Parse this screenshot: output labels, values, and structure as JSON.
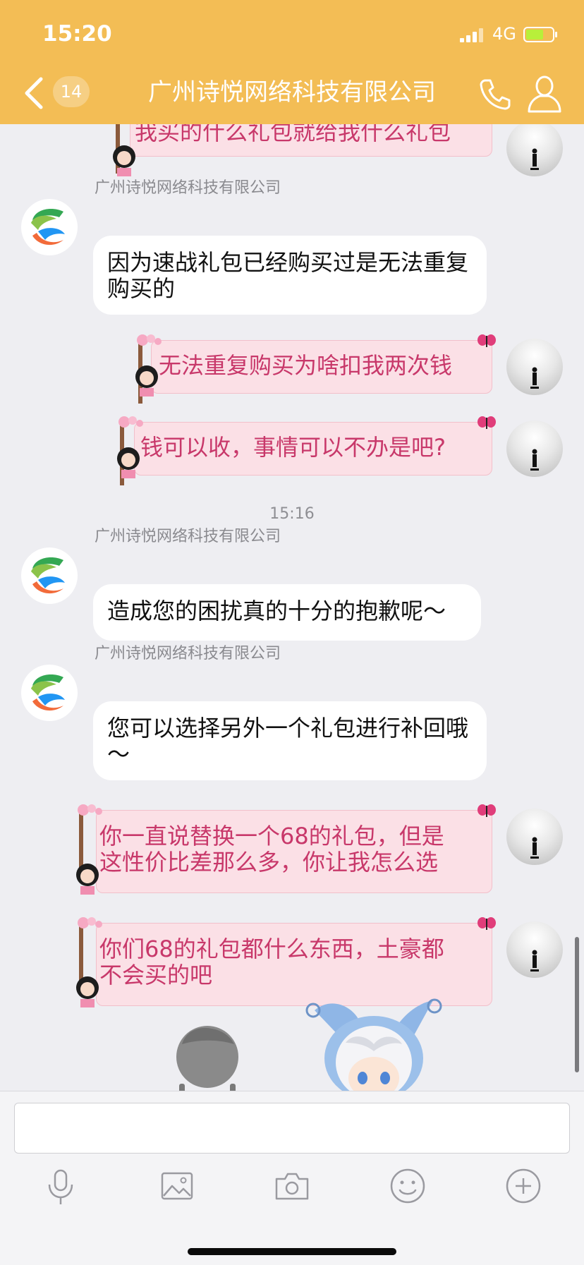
{
  "status_bar": {
    "time": "15:20",
    "network": "4G"
  },
  "header": {
    "unread_count": "14",
    "title": "广州诗悦网络科技有限公司"
  },
  "company_name": "广州诗悦网络科技有限公司",
  "messages": [
    {
      "type": "out",
      "text": "我买的什么礼包就给我什么礼包"
    },
    {
      "type": "in",
      "sender": "广州诗悦网络科技有限公司",
      "text": "因为速战礼包已经购买过是无法重复购买的"
    },
    {
      "type": "out",
      "text": "无法重复购买为啥扣我两次钱"
    },
    {
      "type": "out",
      "text": "钱可以收，事情可以不办是吧?"
    },
    {
      "type": "time",
      "text": "15:16"
    },
    {
      "type": "in",
      "sender": "广州诗悦网络科技有限公司",
      "text": "造成您的困扰真的十分的抱歉呢～"
    },
    {
      "type": "in",
      "sender": "广州诗悦网络科技有限公司",
      "text": "您可以选择另外一个礼包进行补回哦～"
    },
    {
      "type": "out",
      "text": "你一直说替换一个68的礼包，但是\n这性价比差那么多，你让我怎么选"
    },
    {
      "type": "out",
      "text": "你们68的礼包都什么东西，土豪都\n不会买的吧"
    }
  ],
  "toolbar": [
    "microphone-icon",
    "image-icon",
    "camera-icon",
    "emoji-icon",
    "plus-icon"
  ],
  "colors": {
    "header": "#f3bd55",
    "out_bubble": "#fbe0e6",
    "out_text": "#c8386a",
    "background": "#eeeef2"
  }
}
